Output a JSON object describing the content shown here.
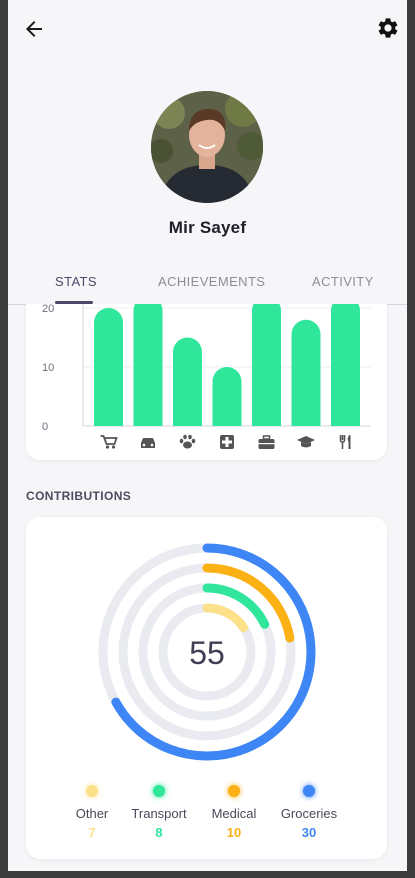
{
  "profile": {
    "name": "Mir Sayef"
  },
  "tabs": [
    {
      "label": "STATS",
      "active": true
    },
    {
      "label": "ACHIEVEMENTS",
      "active": false
    },
    {
      "label": "ACTIVITY",
      "active": false
    }
  ],
  "chart_data": [
    {
      "type": "bar",
      "categories": [
        "cart",
        "car",
        "paw",
        "medical-kit",
        "briefcase",
        "graduation-cap",
        "utensils"
      ],
      "values": [
        20,
        22,
        15,
        10,
        22,
        18,
        22
      ],
      "ylim": [
        0,
        20
      ],
      "yticks": [
        "0",
        "10",
        "20"
      ],
      "grid": true,
      "bar_color": "#2fe69b"
    },
    {
      "type": "ring",
      "title": "CONTRIBUTIONS",
      "center_value": "55",
      "series": [
        {
          "name": "Other",
          "value": "7",
          "color": "#fde08a"
        },
        {
          "name": "Transport",
          "value": "8",
          "color": "#2fe69b"
        },
        {
          "name": "Medical",
          "value": "10",
          "color": "#fbb014"
        },
        {
          "name": "Groceries",
          "value": "30",
          "color": "#3e86f5"
        }
      ],
      "track_color": "#e9ebf0"
    }
  ],
  "icons": {
    "back": "arrow-left-icon",
    "settings": "gear-icon",
    "categories": [
      "shopping-cart-icon",
      "car-icon",
      "paw-icon",
      "medical-kit-icon",
      "briefcase-icon",
      "graduation-cap-icon",
      "utensils-icon"
    ]
  }
}
